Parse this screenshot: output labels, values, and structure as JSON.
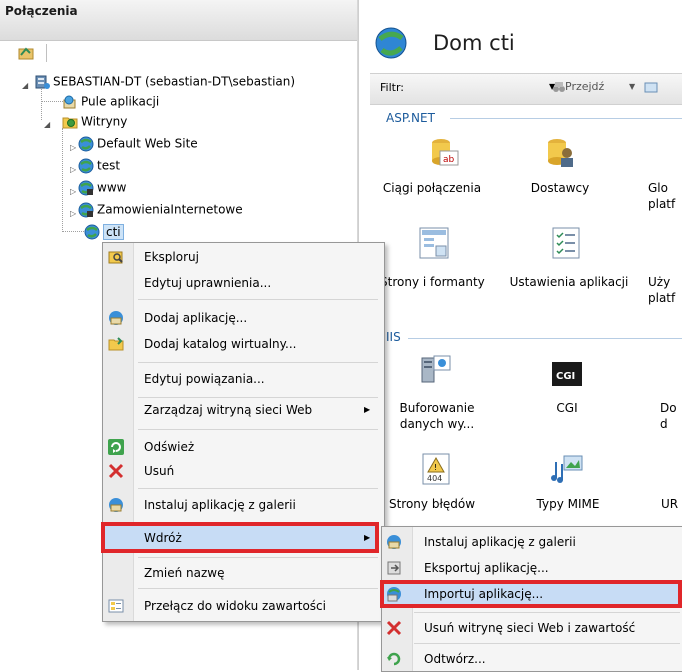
{
  "connections": {
    "title": "Połączenia",
    "tree": {
      "server": "SEBASTIAN-DT (sebastian-DT\\sebastian)",
      "app_pools": "Pule aplikacji",
      "sites": "Witryny",
      "site_items": [
        "Default Web Site",
        "test",
        "www",
        "ZamowieniaInternetowe",
        "cti"
      ]
    }
  },
  "content": {
    "title": "Dom cti",
    "filter_label": "Filtr:",
    "goto_label": "Przejdź",
    "groups": {
      "aspnet": "ASP.NET",
      "iis": "IIS"
    },
    "features": {
      "connection_strings": "Ciągi połączenia",
      "providers": "Dostawcy",
      "glob": [
        "Glo",
        "platf"
      ],
      "pages_controls": "Strony i formanty",
      "app_settings": "Ustawienia aplikacji",
      "uzy": [
        "Uży",
        "platf"
      ],
      "output_cache": [
        "Buforowanie",
        "danych wy..."
      ],
      "cgi": "CGI",
      "do": [
        "Do",
        "d"
      ],
      "error_pages": "Strony błędów",
      "mime": "Typy MIME",
      "ur": "UR"
    },
    "cgi_icon_text": "CGI",
    "error_icon_text": "404"
  },
  "context_menu": {
    "items": [
      "Eksploruj",
      "Edytuj uprawnienia...",
      "Dodaj aplikację...",
      "Dodaj katalog wirtualny...",
      "Edytuj powiązania...",
      "Zarządzaj witryną sieci Web",
      "Odśwież",
      "Usuń",
      "Instaluj aplikację z galerii",
      "Wdróż",
      "Zmień nazwę",
      "Przełącz do widoku zawartości"
    ]
  },
  "submenu": {
    "items": [
      "Instaluj aplikację z galerii",
      "Eksportuj aplikację...",
      "Importuj aplikację...",
      "Usuń witrynę sieci Web i zawartość",
      "Odtwórz..."
    ]
  },
  "colors": {
    "highlight_border": "#e0262a",
    "selection": "#c7dcf5",
    "group_header": "#1c5b9c"
  },
  "icons": [
    "globe-icon",
    "server-icon",
    "app-pool-icon",
    "sites-folder-icon",
    "explore-icon",
    "refresh-icon",
    "delete-icon",
    "gallery-icon"
  ]
}
